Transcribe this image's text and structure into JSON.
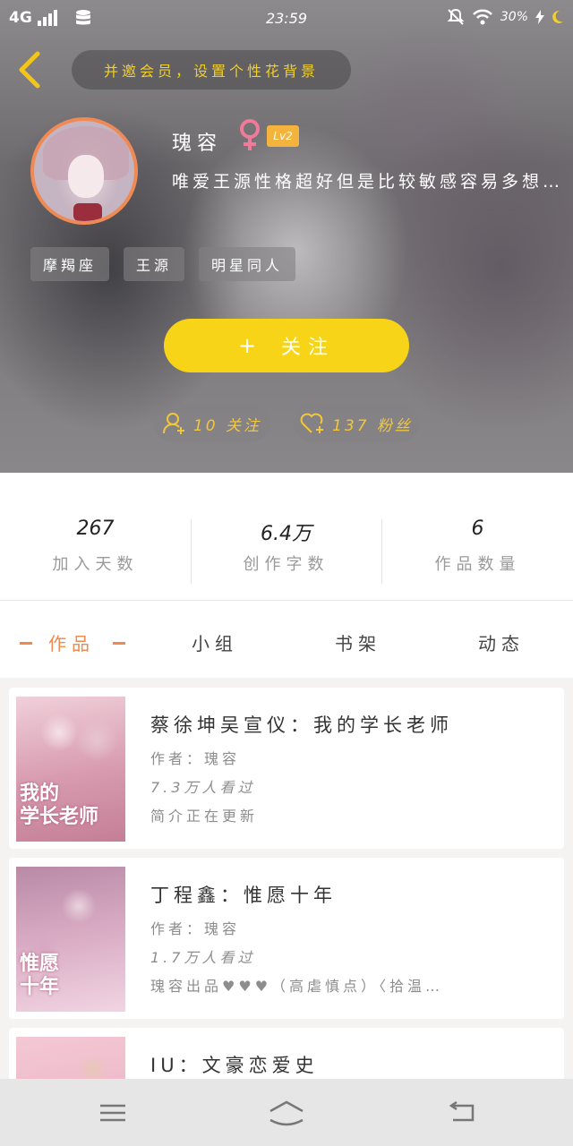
{
  "status_bar": {
    "network": "4G",
    "time": "23:59",
    "battery": "30%"
  },
  "header": {
    "tip": "并邀会员，设置个性花背景",
    "username": "瑰容",
    "level": "Lv2",
    "bio": "唯爱王源性格超好但是比较敏感容易多想…",
    "tags": [
      "摩羯座",
      "王源",
      "明星同人"
    ],
    "follow_label": "关注",
    "following_label": "10 关注",
    "fans_label": "137 粉丝"
  },
  "stats": [
    {
      "value": "267",
      "label": "加入天数"
    },
    {
      "value": "6.4万",
      "label": "创作字数"
    },
    {
      "value": "6",
      "label": "作品数量"
    }
  ],
  "tabs": [
    "作品",
    "小组",
    "书架",
    "动态"
  ],
  "books": [
    {
      "title": "蔡徐坤吴宣仪：我的学长老师",
      "author": "作者：瑰容",
      "views": "7.3万人看过",
      "status": "简介正在更新",
      "cover_text": "我的\n学长老师"
    },
    {
      "title": "丁程鑫：惟愿十年",
      "author": "作者：瑰容",
      "views": "1.7万人看过",
      "status": "瑰容出品♥♥♥（高虐慎点）〈拾温…",
      "cover_text": "惟愿\n十年"
    },
    {
      "title": "IU：文豪恋爱史",
      "author": "",
      "views": "",
      "status": "",
      "cover_text": ""
    }
  ],
  "colors": {
    "accent_yellow": "#f7d417",
    "accent_orange": "#ee8a4c",
    "tip_text": "#f2cf2b"
  }
}
